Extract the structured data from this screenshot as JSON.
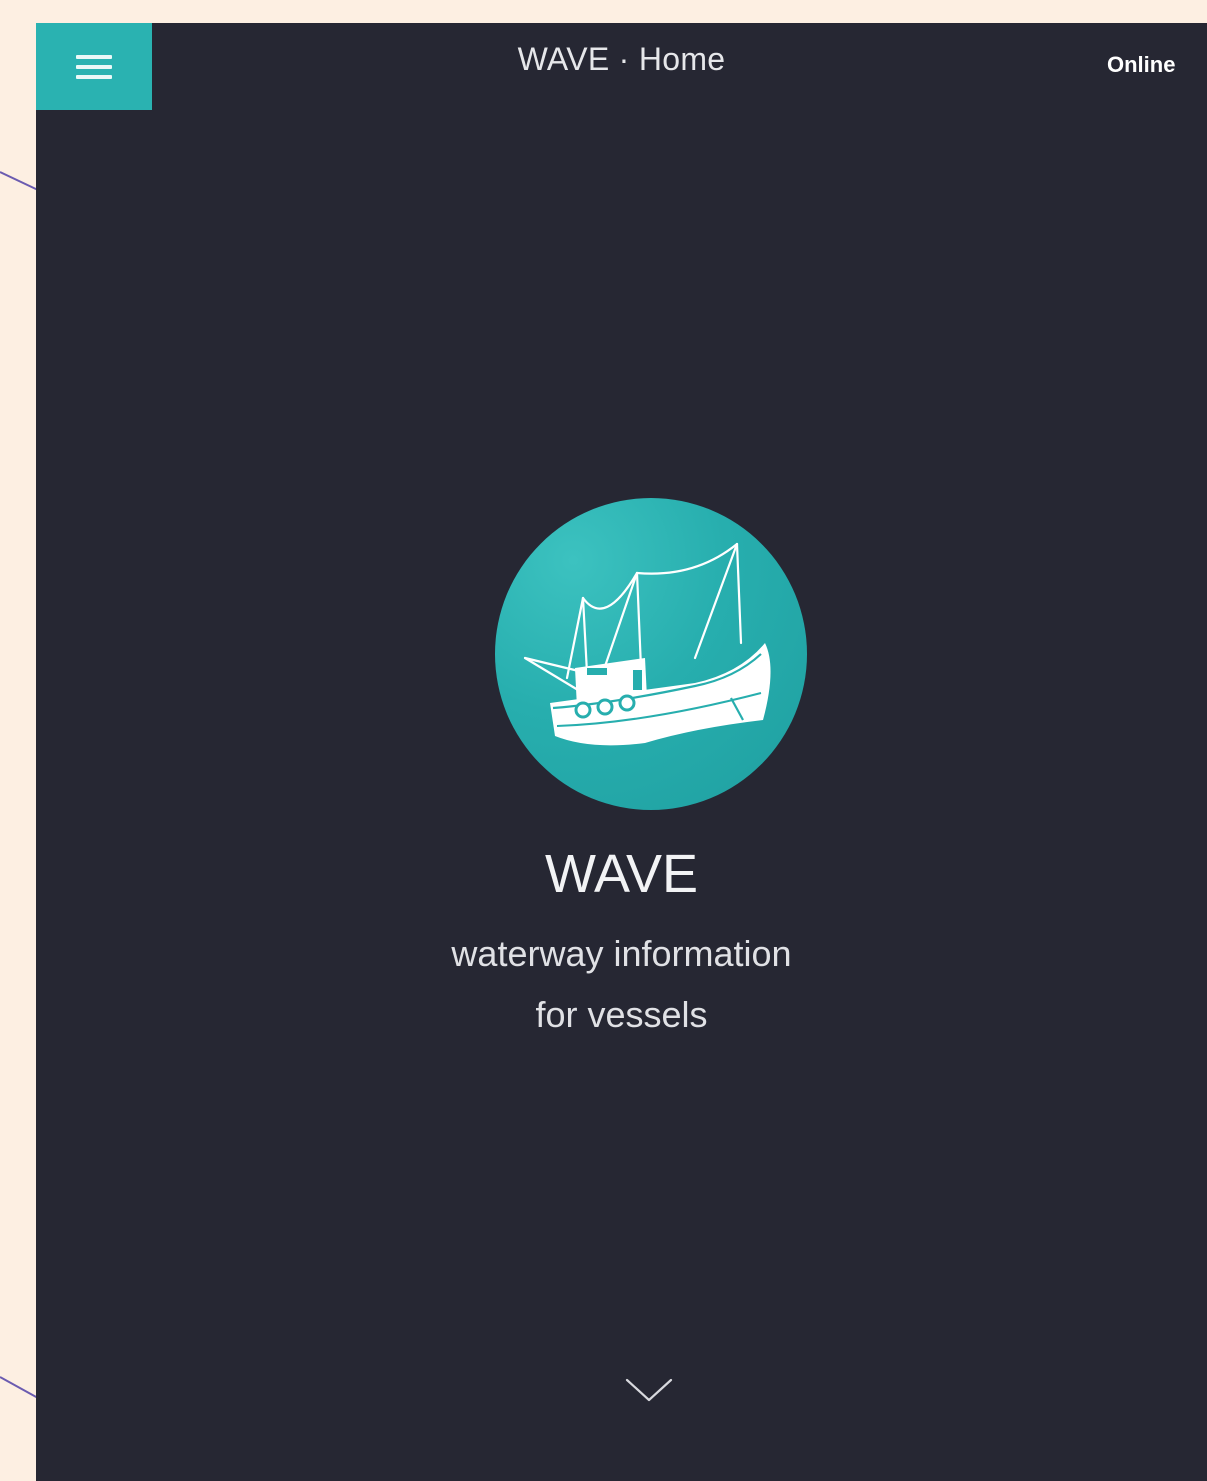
{
  "header": {
    "menu_icon": "hamburger-menu-icon",
    "title": "WAVE · Home",
    "status": "Online"
  },
  "hero": {
    "logo_icon": "fishing-boat-icon",
    "brand_name": "WAVE",
    "tagline_line1": "waterway information",
    "tagline_line2": "for vessels",
    "scroll_icon": "chevron-down-icon"
  },
  "colors": {
    "page_background": "#fdefe2",
    "app_background": "#262733",
    "accent": "#2ab2b1",
    "text": "#e6e7ea",
    "decorative_line": "#6b5bb0"
  }
}
